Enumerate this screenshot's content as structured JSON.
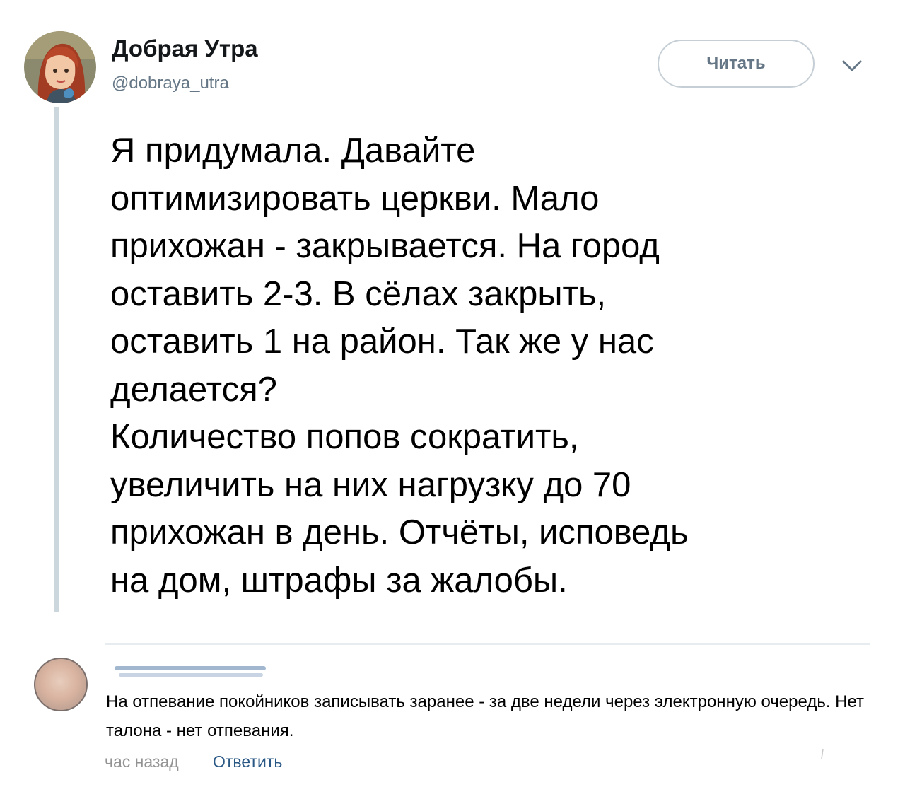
{
  "tweet": {
    "author": {
      "display_name": "Добрая Утра",
      "handle": "@dobraya_utra",
      "avatar_icon": "avatar-illustration-icon"
    },
    "follow_label": "Читать",
    "menu_icon": "chevron-down-icon",
    "text": "Я придумала. Давайте\nоптимизировать церкви. Мало\nприхожан - закрывается. На город\nоставить 2-3. В сёлах закрыть,\nоставить 1 на район. Так же у нас\nделается?\nКоличество попов сократить,\nувеличить на них нагрузку до 70\nприхожан в день. Отчёты, исповедь\nна дом, штрафы за жалобы."
  },
  "comment": {
    "text": "На отпевание покойников записывать заранее - за две недели через электронную очередь. Нет талона - нет отпевания.",
    "time": "час назад",
    "reply_label": "Ответить"
  },
  "colors": {
    "link": "#2a5885",
    "muted": "#657786",
    "thread_line": "#ccd6dd"
  }
}
